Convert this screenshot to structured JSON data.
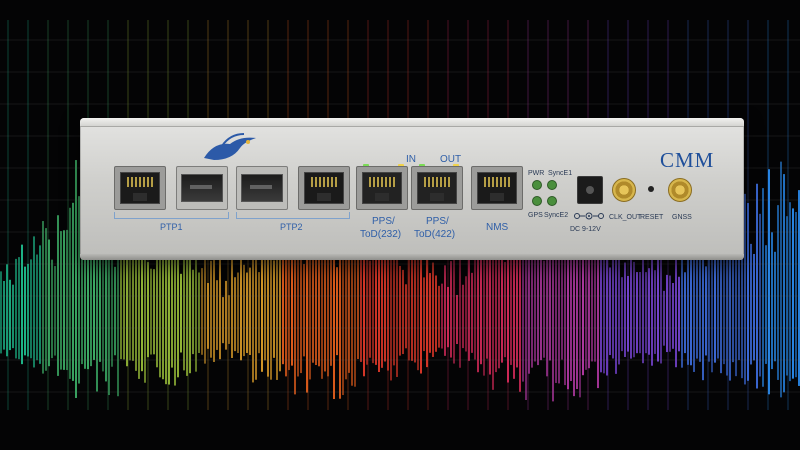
{
  "device": {
    "brand": "CMM",
    "port_labels": {
      "ptp1": "PTP1",
      "ptp2": "PTP2",
      "pps_232_line1": "PPS/",
      "pps_232_line2": "ToD(232)",
      "pps_422_line1": "PPS/",
      "pps_422_line2": "ToD(422)",
      "in": "IN",
      "out": "OUT",
      "nms": "NMS"
    },
    "led_labels": {
      "pwr": "PWR",
      "sync_e1": "SyncE1",
      "gps": "GPS",
      "sync_e2": "SyncE2"
    },
    "power_label": "DC 9-12V",
    "clk_out": "CLK_OUT",
    "reset": "RESET",
    "gnss": "GNSS"
  },
  "background": {
    "colors": [
      "#1fbf8f",
      "#3fb46a",
      "#9cc13a",
      "#e0a02a",
      "#f0631d",
      "#e63a2a",
      "#d62a5a",
      "#b73aa8",
      "#7a46d8",
      "#3e6ee0",
      "#2a8cf0"
    ]
  },
  "icons": [
    "bird-logo-icon",
    "ethernet-port-icon",
    "sfp-port-icon",
    "dc-jack-icon",
    "sma-connector-icon"
  ]
}
